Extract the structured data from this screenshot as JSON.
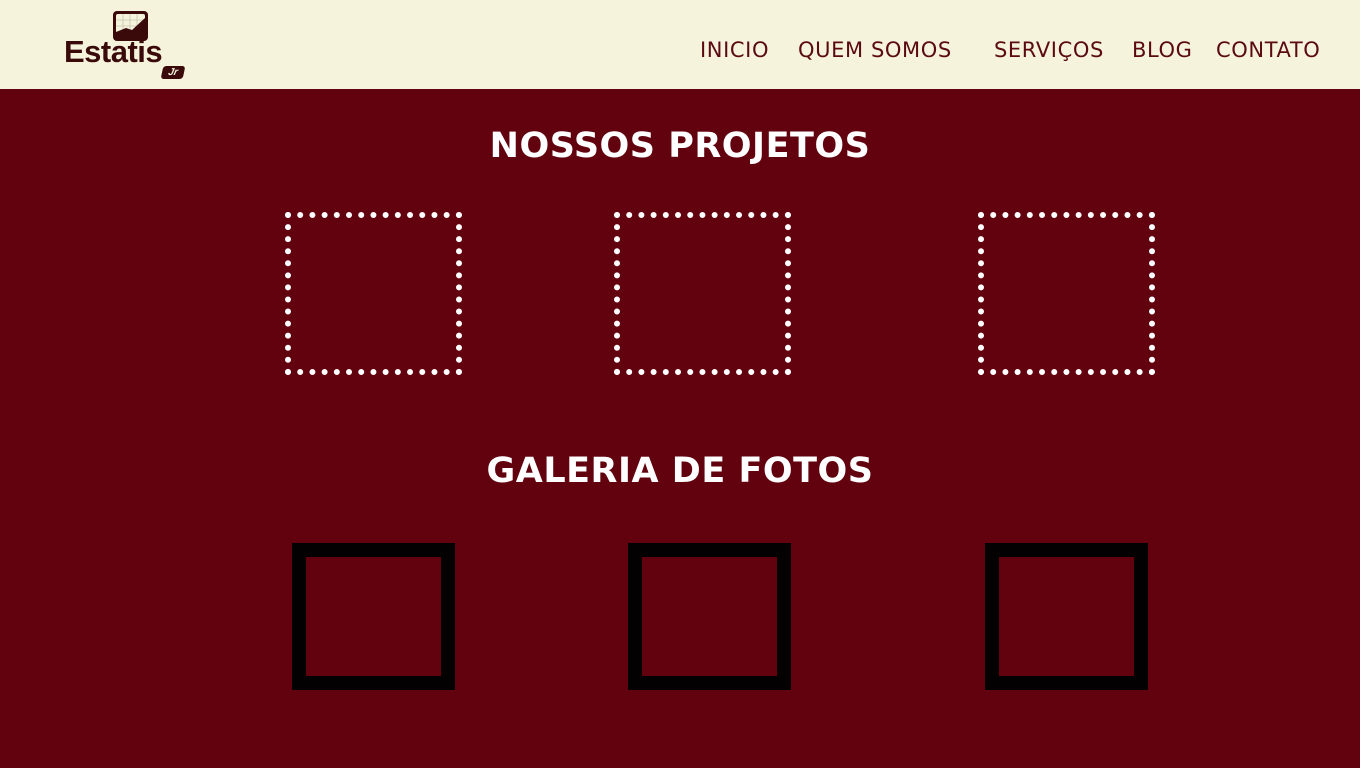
{
  "header": {
    "logo": {
      "name": "Estatis",
      "suffix": "Jr"
    },
    "nav": [
      "INICIO",
      "QUEM SOMOS",
      "SERVIÇOS",
      "BLOG",
      "CONTATO"
    ]
  },
  "projects": {
    "title": "NOSSOS PROJETOS",
    "items": 3
  },
  "gallery": {
    "title": "GALERIA DE FOTOS",
    "items": 3
  },
  "colors": {
    "header_bg": "#f5f3dc",
    "page_bg": "#62020e",
    "nav_text": "#5a0a10",
    "logo_text": "#3a0a0a",
    "title_text": "#ffffff",
    "project_border": "#ffffff",
    "photo_border": "#030101"
  }
}
